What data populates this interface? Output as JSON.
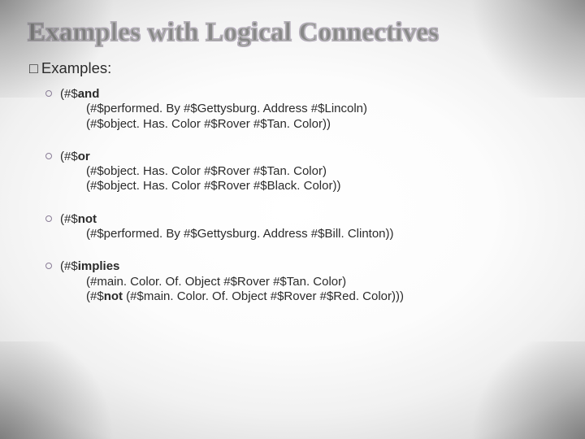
{
  "title": "Examples with Logical Connectives",
  "heading_bullet": "□",
  "heading_text": "Examples:",
  "examples": [
    {
      "op": "and",
      "line1_prefix": "(#$",
      "line2": "(#$performed. By #$Gettysburg. Address #$Lincoln)",
      "line3": "(#$object. Has. Color #$Rover #$Tan. Color))"
    },
    {
      "op": "or",
      "line1_prefix": "(#$",
      "line2": "(#$object. Has. Color #$Rover #$Tan. Color)",
      "line3": "(#$object. Has. Color #$Rover #$Black. Color))"
    },
    {
      "op": "not",
      "line1_prefix": "(#$",
      "line2": "(#$performed. By #$Gettysburg. Address #$Bill. Clinton))",
      "line3": ""
    },
    {
      "op": "implies",
      "line1_prefix": "(#$",
      "line2": "(#main. Color. Of. Object #$Rover #$Tan. Color)",
      "line3_prefix": "(#$",
      "line3_bold": "not",
      "line3_suffix": " (#$main. Color. Of. Object #$Rover #$Red. Color)))"
    }
  ]
}
